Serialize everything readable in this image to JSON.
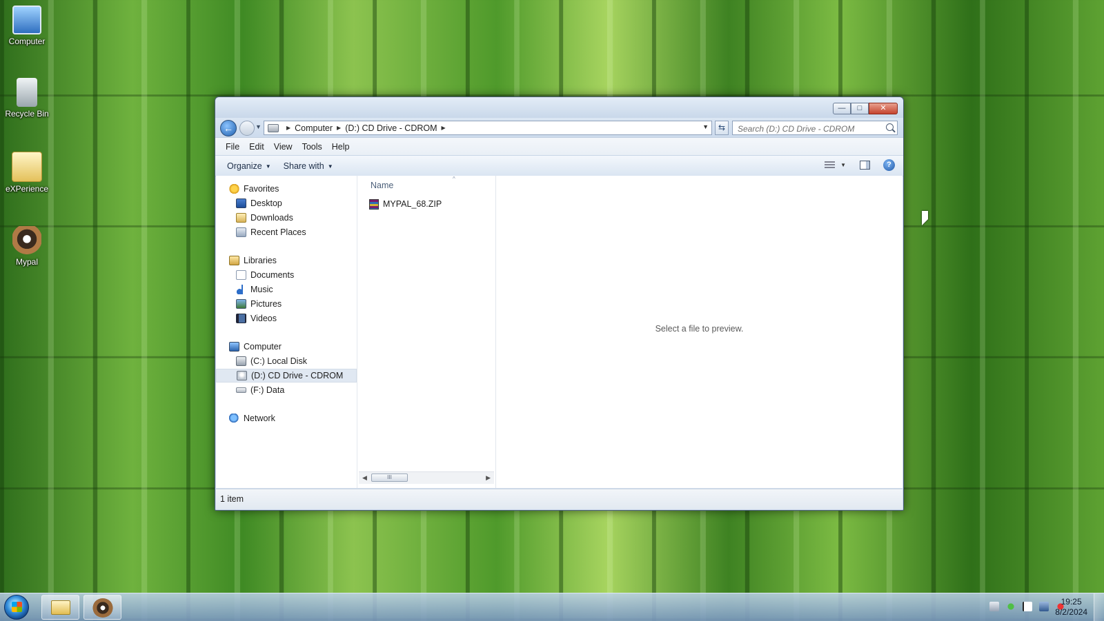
{
  "desktop": {
    "icons": [
      {
        "label": "Computer",
        "icon": "computer-icon"
      },
      {
        "label": "Recycle Bin",
        "icon": "recycle-bin-icon"
      },
      {
        "label": "eXPerience",
        "icon": "folder-icon"
      },
      {
        "label": "Mypal",
        "icon": "mypal-browser-icon"
      }
    ]
  },
  "window": {
    "caption_buttons": {
      "minimize": "—",
      "maximize": "□",
      "close": "✕"
    },
    "nav": {
      "back": "←"
    },
    "address": {
      "crumbs": [
        "Computer",
        "(D:) CD Drive - CDROM"
      ]
    },
    "search": {
      "placeholder": "Search (D:) CD Drive - CDROM"
    },
    "menu": [
      "File",
      "Edit",
      "View",
      "Tools",
      "Help"
    ],
    "commands": {
      "organize": "Organize",
      "share_with": "Share with"
    },
    "help_glyph": "?",
    "navpane": {
      "favorites": {
        "label": "Favorites",
        "items": [
          "Desktop",
          "Downloads",
          "Recent Places"
        ]
      },
      "libraries": {
        "label": "Libraries",
        "items": [
          "Documents",
          "Music",
          "Pictures",
          "Videos"
        ]
      },
      "computer": {
        "label": "Computer",
        "items": [
          "(C:) Local Disk",
          "(D:) CD Drive - CDROM",
          "(F:) Data"
        ],
        "selected_index": 1
      },
      "network": {
        "label": "Network"
      }
    },
    "files": {
      "column_name": "Name",
      "items": [
        {
          "name": "MYPAL_68.ZIP",
          "icon": "zip-archive-icon"
        }
      ],
      "scroll_thumb": "III"
    },
    "preview": {
      "message": "Select a file to preview."
    },
    "status": {
      "item_count": "1 item"
    }
  },
  "taskbar": {
    "clock": {
      "time": "19:25",
      "date": "8/2/2024"
    }
  },
  "colors": {
    "window_frame": "#cfdcec",
    "selection": "#e0e8f2",
    "close_button": "#c5442f"
  }
}
